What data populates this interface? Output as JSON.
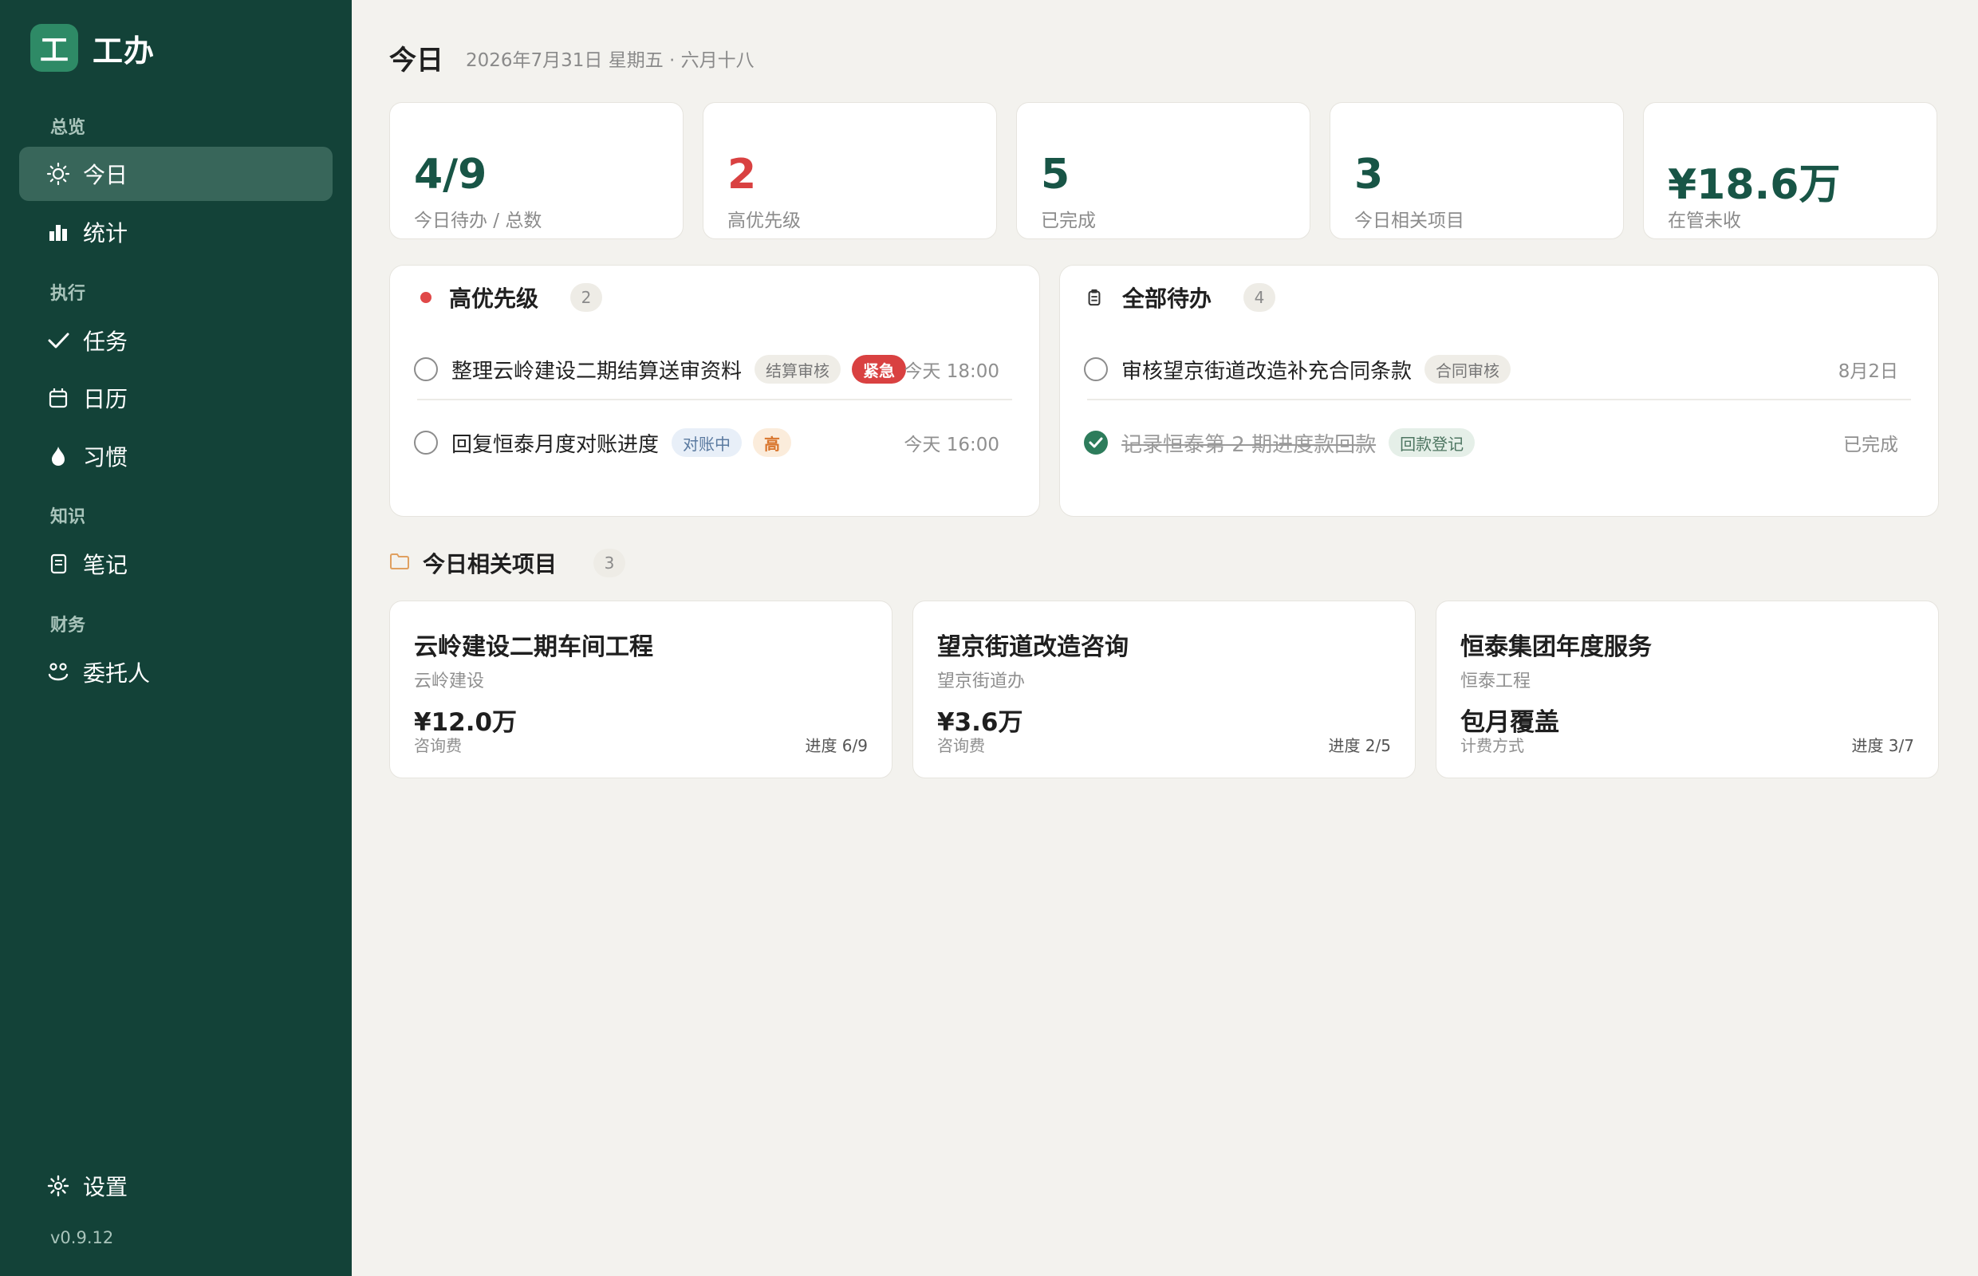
{
  "app": {
    "logo_char": "工",
    "name": "工办",
    "version": "v0.9.12",
    "accent": "#134238"
  },
  "sidebar": {
    "sections": {
      "overview": "总览",
      "execution": "执行",
      "knowledge": "知识",
      "finance": "财务"
    },
    "items": [
      {
        "label": "今日",
        "icon": "sun-icon",
        "active": true
      },
      {
        "label": "统计",
        "icon": "bar-chart-icon"
      },
      {
        "label": "任务",
        "icon": "check-icon"
      },
      {
        "label": "日历",
        "icon": "calendar-icon"
      },
      {
        "label": "习惯",
        "icon": "flame-icon"
      },
      {
        "label": "笔记",
        "icon": "note-icon"
      },
      {
        "label": "委托人",
        "icon": "people-icon"
      }
    ],
    "settings": {
      "label": "设置",
      "icon": "gear-icon"
    }
  },
  "header": {
    "title": "今日",
    "date": "2026年7月31日 星期五 · 六月十八"
  },
  "stats": [
    {
      "value": "4/9",
      "label": "今日待办 / 总数"
    },
    {
      "value": "2",
      "label": "高优先级"
    },
    {
      "value": "5",
      "label": "已完成"
    },
    {
      "value": "3",
      "label": "今日相关项目"
    },
    {
      "value": "¥18.6万",
      "label": "在管未收"
    }
  ],
  "high_priority": {
    "title": "高优先级",
    "count": "2",
    "tasks": [
      {
        "text": "整理云岭建设二期结算送审资料",
        "tag": "结算审核",
        "priority": "紧急",
        "time": "今天 18:00"
      },
      {
        "text": "回复恒泰月度对账进度",
        "tag": "对账中",
        "priority": "高",
        "time": "今天 16:00"
      }
    ]
  },
  "all_todo": {
    "title": "全部待办",
    "count": "4",
    "tasks": [
      {
        "text": "审核望京街道改造补充合同条款",
        "tag": "合同审核",
        "time": "8月2日",
        "done": false
      },
      {
        "text": "记录恒泰第 2 期进度款回款",
        "tag": "回款登记",
        "time": "已完成",
        "done": true
      }
    ]
  },
  "projects_section": {
    "title": "今日相关项目",
    "count": "3"
  },
  "projects": [
    {
      "name": "云岭建设二期车间工程",
      "client": "云岭建设",
      "amount": "¥12.0万",
      "unit": "咨询费",
      "progress": "进度 6/9"
    },
    {
      "name": "望京街道改造咨询",
      "client": "望京街道办",
      "amount": "¥3.6万",
      "unit": "咨询费",
      "progress": "进度 2/5"
    },
    {
      "name": "恒泰集团年度服务",
      "client": "恒泰工程",
      "amount": "包月覆盖",
      "unit": "计费方式",
      "progress": "进度 3/7"
    }
  ]
}
